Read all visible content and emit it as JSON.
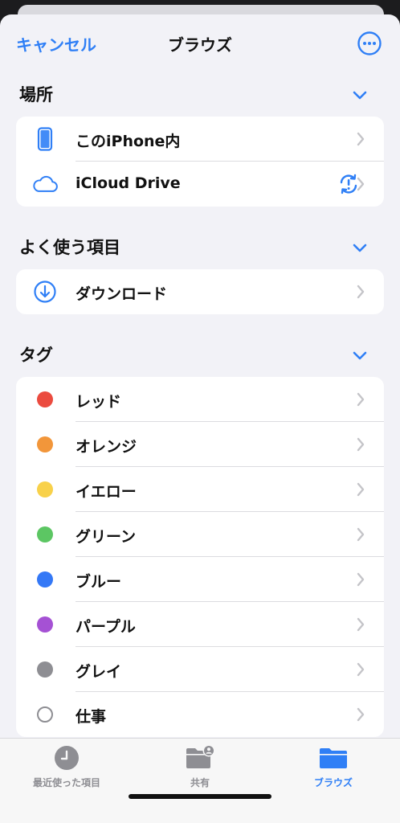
{
  "header": {
    "cancel_label": "キャンセル",
    "title": "ブラウズ",
    "more_icon": "ellipsis-circle-icon"
  },
  "sections": {
    "locations": {
      "title": "場所",
      "items": [
        {
          "label": "このiPhone内",
          "icon": "iphone-icon"
        },
        {
          "label": "iCloud Drive",
          "icon": "cloud-icon",
          "status_icon": "sync-alert-icon"
        }
      ]
    },
    "favorites": {
      "title": "よく使う項目",
      "items": [
        {
          "label": "ダウンロード",
          "icon": "download-circle-icon"
        }
      ]
    },
    "tags": {
      "title": "タグ",
      "items": [
        {
          "label": "レッド",
          "color": "#eb4b3f"
        },
        {
          "label": "オレンジ",
          "color": "#f2963a"
        },
        {
          "label": "イエロー",
          "color": "#f8d14a"
        },
        {
          "label": "グリーン",
          "color": "#5cc663"
        },
        {
          "label": "ブルー",
          "color": "#3478f6"
        },
        {
          "label": "パープル",
          "color": "#a551d4"
        },
        {
          "label": "グレイ",
          "color": "#8e8e93"
        },
        {
          "label": "仕事",
          "color": "outline"
        }
      ]
    }
  },
  "tabbar": {
    "tabs": [
      {
        "label": "最近使った項目",
        "icon": "clock-icon",
        "active": false
      },
      {
        "label": "共有",
        "icon": "shared-folder-icon",
        "active": false
      },
      {
        "label": "ブラウズ",
        "icon": "folder-icon",
        "active": true
      }
    ]
  },
  "colors": {
    "accent": "#2f7ff6",
    "background": "#f2f2f7"
  }
}
